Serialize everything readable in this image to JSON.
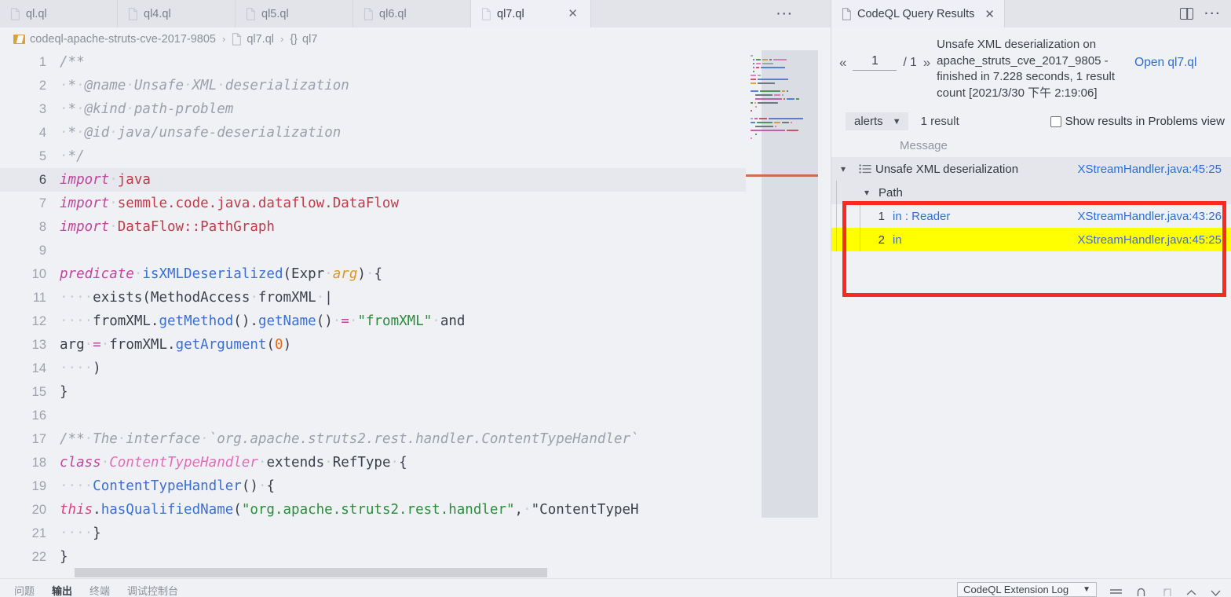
{
  "editor": {
    "tabs": [
      {
        "label": "ql.ql",
        "active": false,
        "icon": "file-icon"
      },
      {
        "label": "ql4.ql",
        "active": false,
        "icon": "file-icon"
      },
      {
        "label": "ql5.ql",
        "active": false,
        "icon": "file-icon"
      },
      {
        "label": "ql6.ql",
        "active": false,
        "icon": "file-icon"
      },
      {
        "label": "ql7.ql",
        "active": true,
        "icon": "file-icon"
      }
    ],
    "tabbar_more": "···",
    "breadcrumb": {
      "folder": "codeql-apache-struts-cve-2017-9805",
      "file": "ql7.ql",
      "symbol": "ql7",
      "symbol_icon": "{}",
      "separator": "›"
    },
    "current_line": 6,
    "lines": [
      {
        "n": 1,
        "raw": "/**"
      },
      {
        "n": 2,
        "raw": " * @name Unsafe XML deserialization"
      },
      {
        "n": 3,
        "raw": " * @kind path-problem"
      },
      {
        "n": 4,
        "raw": " * @id java/unsafe-deserialization"
      },
      {
        "n": 5,
        "raw": " */"
      },
      {
        "n": 6,
        "raw": "import java"
      },
      {
        "n": 7,
        "raw": "import semmle.code.java.dataflow.DataFlow"
      },
      {
        "n": 8,
        "raw": "import DataFlow::PathGraph"
      },
      {
        "n": 9,
        "raw": ""
      },
      {
        "n": 10,
        "raw": "predicate isXMLDeserialized(Expr arg) {"
      },
      {
        "n": 11,
        "raw": "    exists(MethodAccess fromXML |"
      },
      {
        "n": 12,
        "raw": "    fromXML.getMethod().getName() = \"fromXML\" and"
      },
      {
        "n": 13,
        "raw": "arg = fromXML.getArgument(0)"
      },
      {
        "n": 14,
        "raw": "    )"
      },
      {
        "n": 15,
        "raw": "}"
      },
      {
        "n": 16,
        "raw": ""
      },
      {
        "n": 17,
        "raw": "/** The interface `org.apache.struts2.rest.handler.ContentTypeHandler`"
      },
      {
        "n": 18,
        "raw": "class ContentTypeHandler extends RefType {"
      },
      {
        "n": 19,
        "raw": "    ContentTypeHandler() {"
      },
      {
        "n": 20,
        "raw": "this.hasQualifiedName(\"org.apache.struts2.rest.handler\", \"ContentTypeH"
      },
      {
        "n": 21,
        "raw": "    }"
      },
      {
        "n": 22,
        "raw": "}"
      }
    ]
  },
  "results": {
    "tab_label": "CodeQL Query Results",
    "tab_close": "✕",
    "split_icon": "split-editor-icon",
    "more_icon": "···",
    "pager": {
      "prev": "«",
      "next": "»",
      "page": "1",
      "total": "/ 1"
    },
    "summary": "Unsafe XML deserialization on apache_struts_cve_2017_9805 - finished in 7.228 seconds, 1 result count [2021/3/30 下午 2:19:06]",
    "open_link": "Open ql7.ql",
    "select_value": "alerts",
    "select_caret": "⌄",
    "result_count": "1 result",
    "problems_checkbox_label": "Show results in Problems view",
    "problems_checkbox_checked": false,
    "column_header": "Message",
    "rows": [
      {
        "type": "alert",
        "chevron": "⌄",
        "icon": "list-icon",
        "message": "Unsafe XML deserialization",
        "location": "XStreamHandler.java:45:25",
        "highlight": false,
        "shaded": true
      },
      {
        "type": "path",
        "chevron": "⌄",
        "message": "Path",
        "location": "",
        "highlight": false,
        "shaded": true
      },
      {
        "type": "step",
        "index": "1",
        "message": "in : Reader",
        "location": "XStreamHandler.java:43:26",
        "highlight": false,
        "shaded": false
      },
      {
        "type": "step",
        "index": "2",
        "message": "in",
        "location": "XStreamHandler.java:45:25",
        "highlight": true,
        "shaded": false
      }
    ],
    "annotation_color": "#fb2a20",
    "highlight_color": "#ffff00",
    "link_color": "#2b6fd4"
  },
  "bottom_panel": {
    "tabs": [
      {
        "label": "问题",
        "active": false
      },
      {
        "label": "输出",
        "active": true
      },
      {
        "label": "终端",
        "active": false
      },
      {
        "label": "调试控制台",
        "active": false
      }
    ],
    "channel_select": "CodeQL Extension Log",
    "channel_caret": "⌄",
    "icons": [
      "clear-output-icon",
      "lock-icon",
      "split-output-icon",
      "chevron-up-icon",
      "close-icon"
    ]
  }
}
